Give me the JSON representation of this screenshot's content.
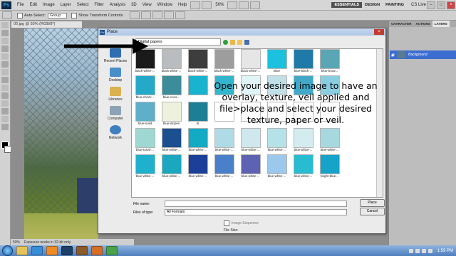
{
  "ps": {
    "logo": "Ps",
    "menu": [
      "File",
      "Edit",
      "Image",
      "Layer",
      "Select",
      "Filter",
      "Analysis",
      "3D",
      "View",
      "Window",
      "Help"
    ],
    "zoom": "50%",
    "workspaces": [
      "ESSENTIALS",
      "DESIGN",
      "PAINTING"
    ],
    "cslive": "CS Live",
    "options": {
      "auto_select": "Auto-Select:",
      "group": "Group",
      "transform": "Show Transform Controls"
    },
    "doc_tab": "00.jpg @ 50% (RGB/8*)",
    "status": {
      "zoom": "50%",
      "message": "Exposure works in 32-bit only"
    }
  },
  "panels": {
    "tabs": [
      "CHARACTER",
      "ACTIONS",
      "LAYERS"
    ],
    "layer_name": "Background"
  },
  "dialog": {
    "title": "Place",
    "look_in": "Digital papers",
    "places": [
      "Recent Places",
      "Desktop",
      "Libraries",
      "Computer",
      "Network"
    ],
    "files": [
      {
        "label": "black-white-...",
        "color": "#1a1a1a"
      },
      {
        "label": "black-white-...",
        "color": "#b9bdbf"
      },
      {
        "label": "black-white-...",
        "color": "#3d3d3d"
      },
      {
        "label": "black-white-...",
        "color": "#9d9d9d"
      },
      {
        "label": "black-white-...",
        "color": "#e6e6e6"
      },
      {
        "label": "Blue",
        "color": "#1cc1dd"
      },
      {
        "label": "blue-black-...",
        "color": "#1f7aa8"
      },
      {
        "label": "blue-brow...",
        "color": "#5aa6b4"
      },
      {
        "label": "blue-check...",
        "color": "#25a9c9"
      },
      {
        "label": "blue-coco...",
        "color": "#3c8c9a"
      },
      {
        "label": "",
        "color": "#17b3cf"
      },
      {
        "label": "",
        "color": "#31b6cd"
      },
      {
        "label": "",
        "color": "#e0f5f7"
      },
      {
        "label": "",
        "color": "#c1dfe7"
      },
      {
        "label": "",
        "color": "#41a8c8"
      },
      {
        "label": "",
        "color": "#8acde0"
      },
      {
        "label": "blue-solid",
        "color": "#5fafc8"
      },
      {
        "label": "blue-stripes",
        "color": "#eef2dd"
      },
      {
        "label": "bl",
        "color": "#1d7f96"
      },
      {
        "label": "",
        "color": "#ffffff"
      },
      {
        "label": "",
        "color": "#ffffff"
      },
      {
        "label": "",
        "color": "#ffffff"
      },
      {
        "label": "",
        "color": "#ffffff"
      },
      {
        "label": "",
        "color": "#ffffff"
      },
      {
        "label": "blue-tonal-...",
        "color": "#9fd8d2"
      },
      {
        "label": "blue-white-...",
        "color": "#1b4f8f"
      },
      {
        "label": "blue-white-...",
        "color": "#13aac4"
      },
      {
        "label": "blue-white-...",
        "color": "#aedbe6"
      },
      {
        "label": "blue-white-...",
        "color": "#cfe8ee"
      },
      {
        "label": "blue-white-...",
        "color": "#b5e2e9"
      },
      {
        "label": "blue-white-...",
        "color": "#d2ecf0"
      },
      {
        "label": "blue-white-...",
        "color": "#a6d8e0"
      },
      {
        "label": "blue-white-...",
        "color": "#1fb0ce"
      },
      {
        "label": "blue-white-...",
        "color": "#1aa7bf"
      },
      {
        "label": "blue-white-...",
        "color": "#1c3f9a"
      },
      {
        "label": "blue-white-...",
        "color": "#4a7fc9"
      },
      {
        "label": "blue-white-...",
        "color": "#5d62b3"
      },
      {
        "label": "blue-white-...",
        "color": "#9cc8ec"
      },
      {
        "label": "blue-white-...",
        "color": "#28bcd1"
      },
      {
        "label": "bright-blue...",
        "color": "#16a3c9"
      }
    ],
    "file_name_label": "File name:",
    "file_type_label": "Files of type:",
    "file_type_value": "All Formats",
    "place_button": "Place",
    "cancel_button": "Cancel",
    "image_sequence": "Image Sequence",
    "file_size": "File Size:"
  },
  "overlay_text": "Open your desired image to have an overlay, texture, veil applied and file>place and select your desired texture, paper or veil.",
  "taskbar": {
    "clock": "1:59 PM"
  }
}
